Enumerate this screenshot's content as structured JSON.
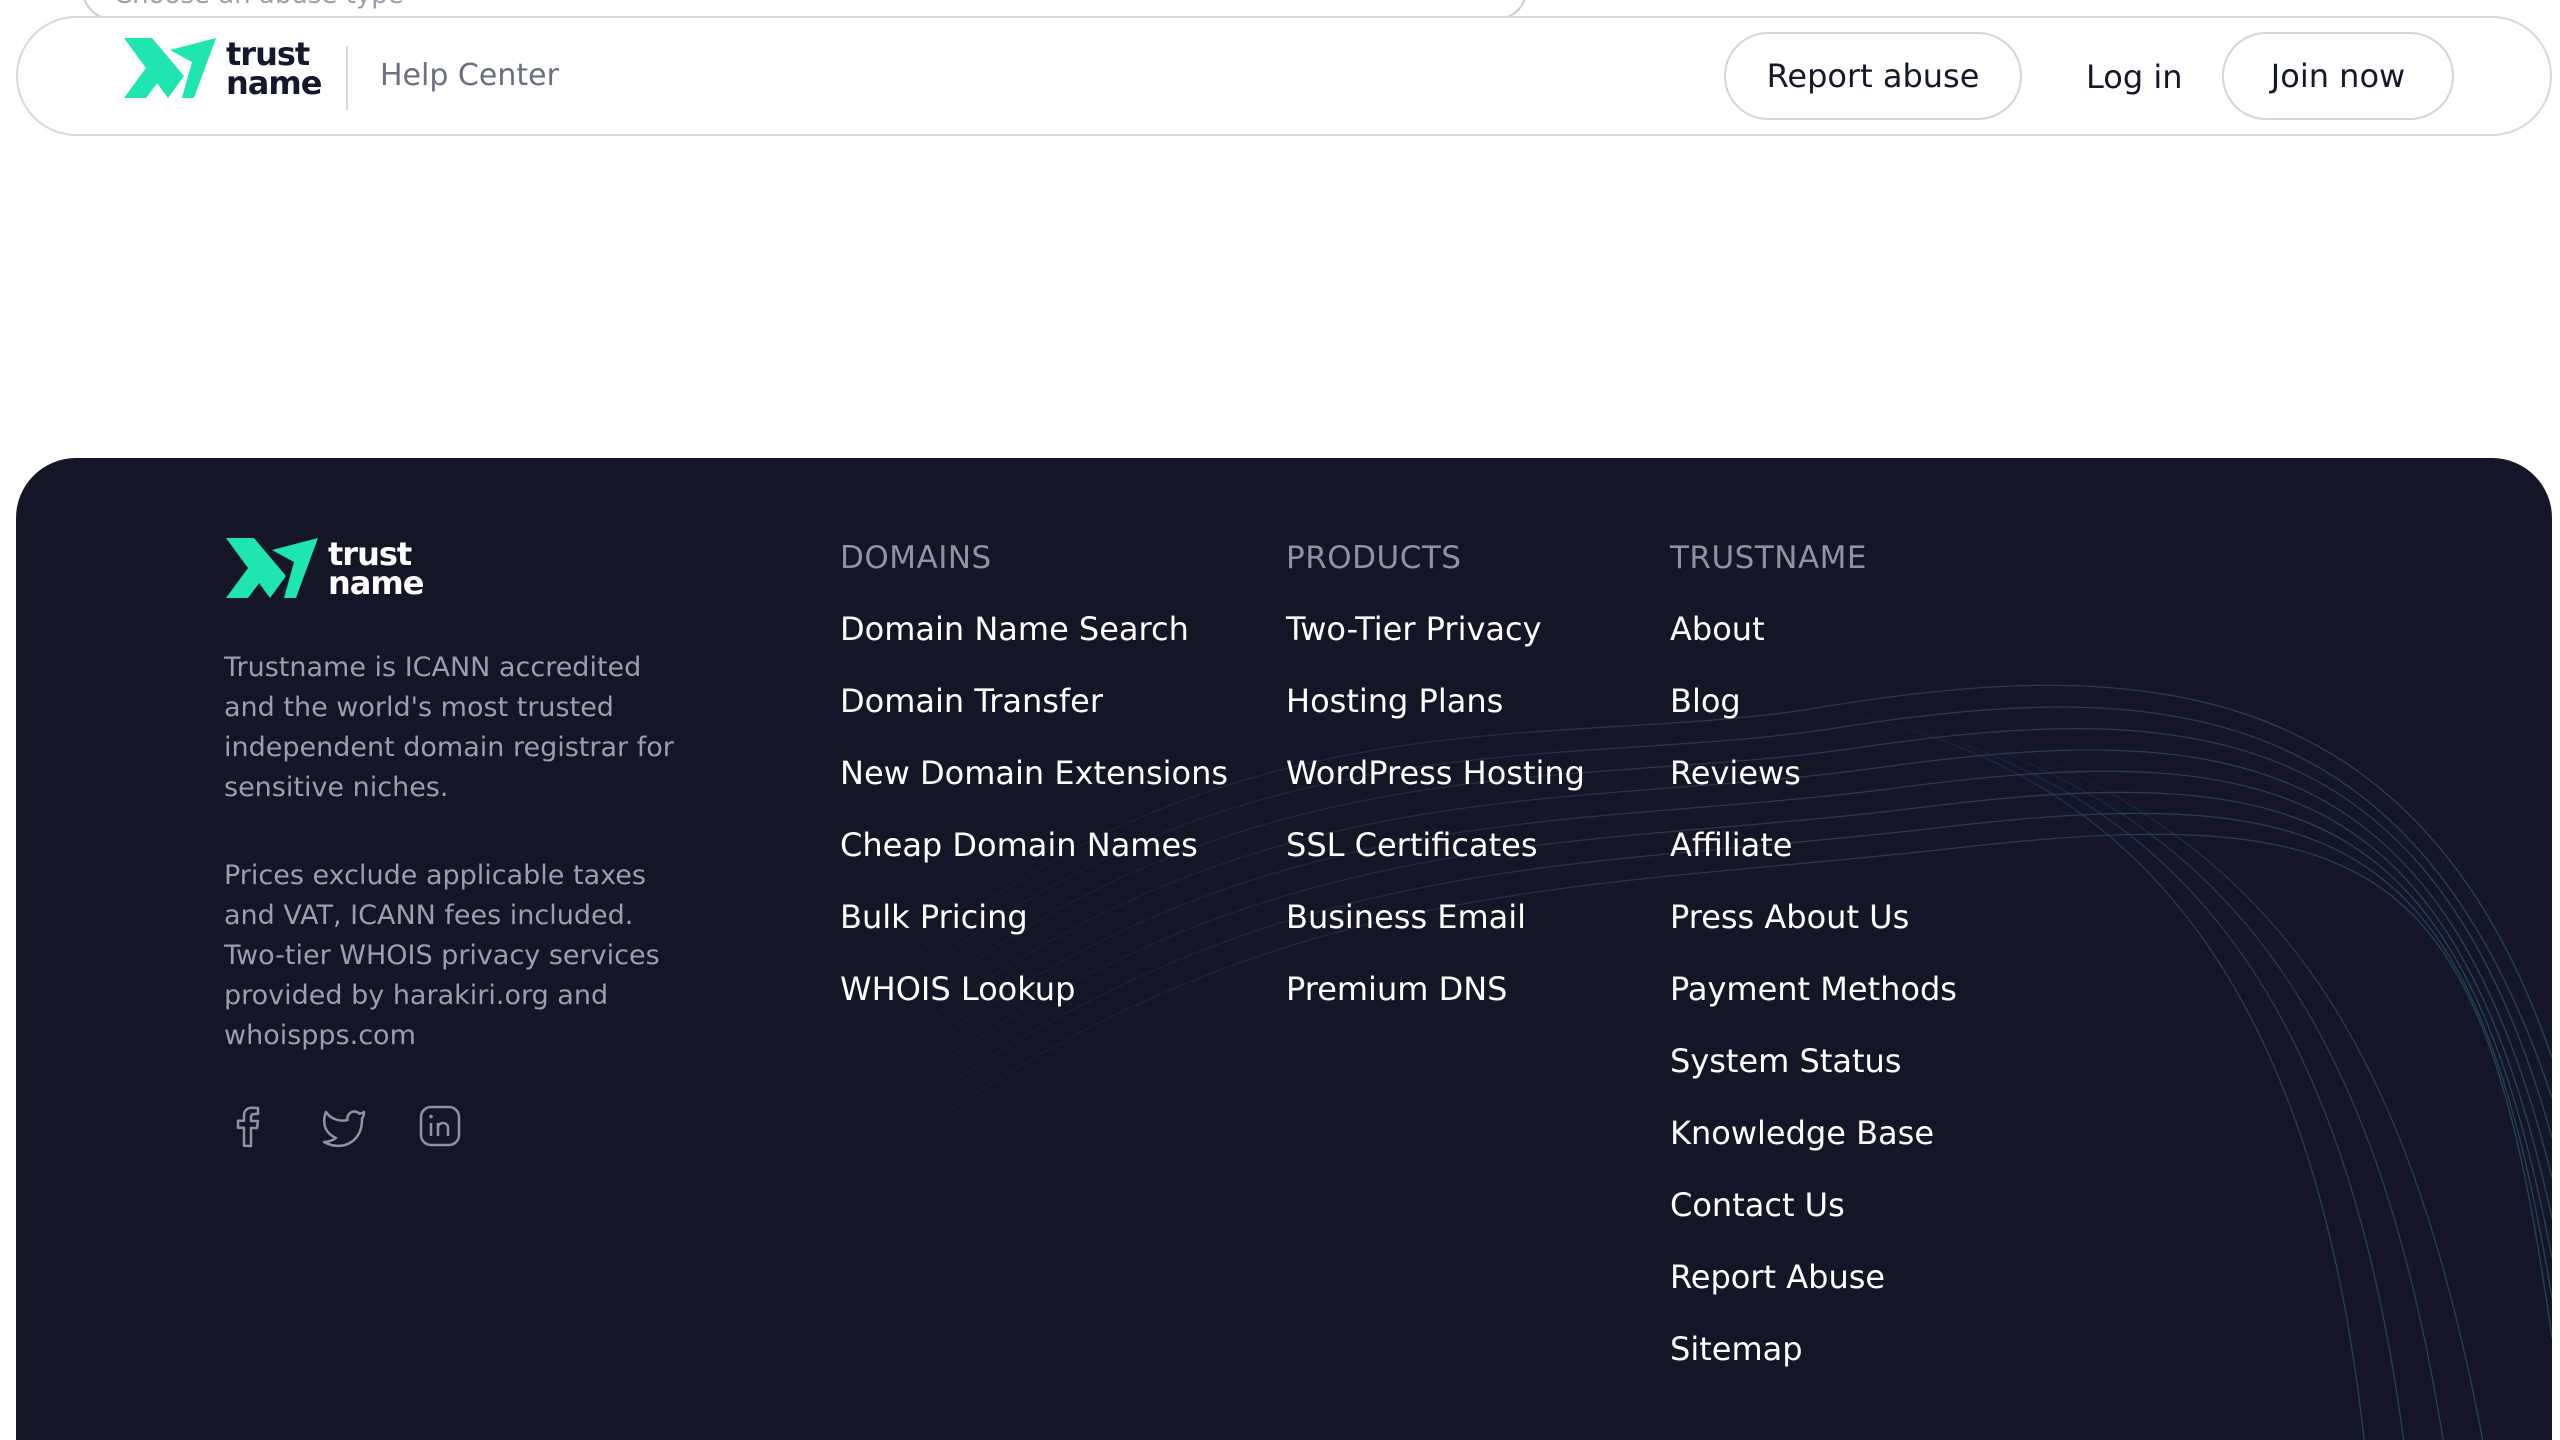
{
  "top_select": {
    "placeholder": "Choose an abuse type"
  },
  "header": {
    "logo_line1": "trust",
    "logo_line2": "name",
    "section": "Help Center",
    "report_abuse": "Report abuse",
    "login": "Log in",
    "join": "Join now"
  },
  "footer": {
    "logo_line1": "trust",
    "logo_line2": "name",
    "description": "Trustname is ICANN accredited and the world's most trusted independent domain registrar for sensitive niches.",
    "disclaimer": "Prices exclude applicable taxes and VAT, ICANN fees included. Two-tier WHOIS privacy services provided by harakiri.org and whoispps.com",
    "socials": [
      "facebook-icon",
      "twitter-icon",
      "linkedin-icon"
    ],
    "columns": [
      {
        "title": "DOMAINS",
        "links": [
          "Domain Name Search",
          "Domain Transfer",
          "New Domain Extensions",
          "Cheap Domain Names",
          "Bulk Pricing",
          "WHOIS Lookup"
        ]
      },
      {
        "title": "PRODUCTS",
        "links": [
          "Two-Tier Privacy",
          "Hosting Plans",
          "WordPress Hosting",
          "SSL Certificates",
          "Business Email",
          "Premium DNS"
        ]
      },
      {
        "title": "TRUSTNAME",
        "links": [
          "About",
          "Blog",
          "Reviews",
          "Affiliate",
          "Press About Us",
          "Payment Methods",
          "System Status",
          "Knowledge Base",
          "Contact Us",
          "Report Abuse",
          "Sitemap"
        ]
      }
    ]
  },
  "colors": {
    "brand_green": "#1fe5b1",
    "footer_bg": "#141628",
    "text_dark": "#15182b"
  }
}
